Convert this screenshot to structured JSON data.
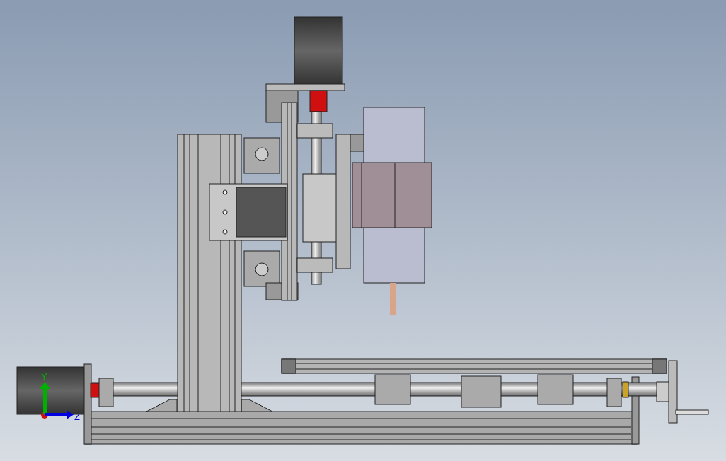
{
  "viewport": {
    "triad": {
      "axes": [
        {
          "kind": "vertical",
          "label": "Y",
          "color": "#00b000"
        },
        {
          "kind": "horizontal",
          "label": "Z",
          "color": "#0000e0"
        }
      ]
    }
  }
}
